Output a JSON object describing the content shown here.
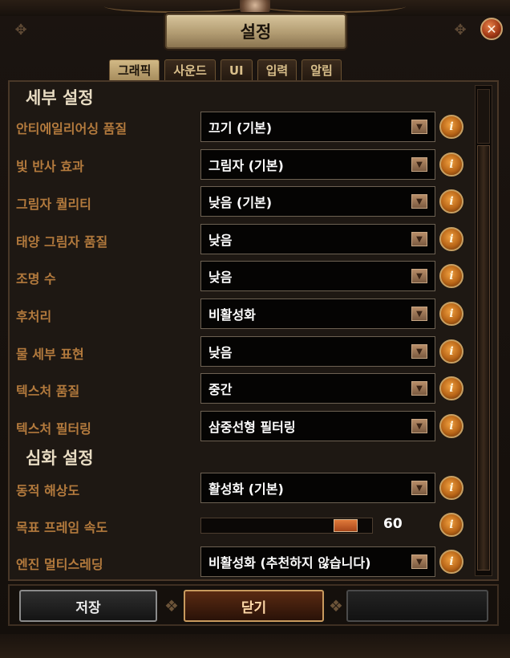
{
  "window": {
    "title": "설정",
    "close_icon": "close-icon",
    "close_glyph": "✕"
  },
  "tabs": [
    {
      "label": "그래픽",
      "active": true
    },
    {
      "label": "사운드",
      "active": false
    },
    {
      "label": "UI",
      "active": false
    },
    {
      "label": "입력",
      "active": false
    },
    {
      "label": "알림",
      "active": false
    }
  ],
  "sections": {
    "detail": "세부 설정",
    "advanced": "심화 설정"
  },
  "settings": [
    {
      "label": "안티에일리어싱 품질",
      "value": "끄기 (기본)"
    },
    {
      "label": "빛 반사 효과",
      "value": "그림자 (기본)"
    },
    {
      "label": "그림자 퀄리티",
      "value": "낮음 (기본)"
    },
    {
      "label": "태양 그림자 품질",
      "value": "낮음"
    },
    {
      "label": "조명 수",
      "value": "낮음"
    },
    {
      "label": "후처리",
      "value": "비활성화"
    },
    {
      "label": "물 세부 표현",
      "value": "낮음"
    },
    {
      "label": "텍스처 품질",
      "value": "중간"
    },
    {
      "label": "텍스처 필터링",
      "value": "삼중선형 필터링"
    }
  ],
  "advanced_settings": {
    "dynamic_resolution": {
      "label": "동적 해상도",
      "value": "활성화 (기본)"
    },
    "target_framerate": {
      "label": "목표 프레임 속도",
      "value": "60",
      "slider_fraction": 0.9
    },
    "engine_multithreading": {
      "label": "엔진 멀티스레딩",
      "value": "비활성화 (추천하지 않습니다)"
    }
  },
  "glyphs": {
    "dropdown_arrow": "▼",
    "info": "i"
  },
  "footer": {
    "save_label": "저장",
    "close_label": "닫기"
  }
}
